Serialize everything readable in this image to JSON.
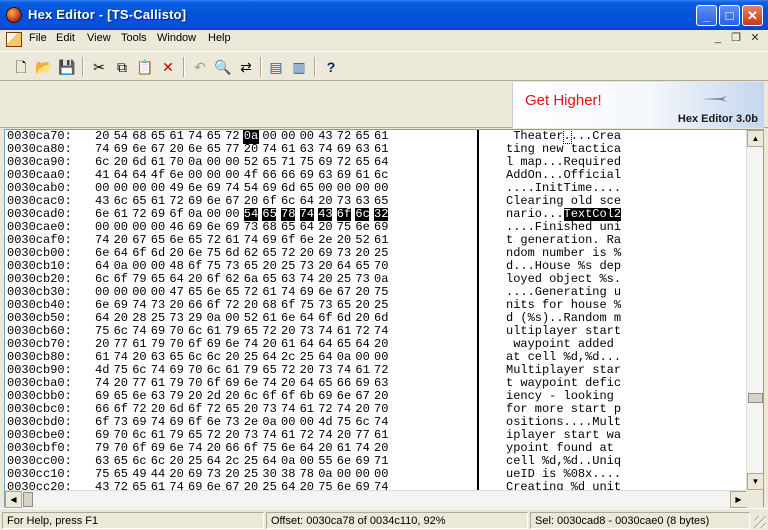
{
  "window": {
    "title": "Hex Editor - [TS-Callisto]"
  },
  "menu": {
    "items": [
      "File",
      "Edit",
      "View",
      "Tools",
      "Window",
      "Help"
    ]
  },
  "toolbar": {
    "buttons": [
      {
        "name": "new-icon",
        "glyph": "🗋"
      },
      {
        "name": "open-icon",
        "glyph": "📂"
      },
      {
        "name": "save-icon",
        "glyph": "💾"
      },
      {
        "name": "cut-icon",
        "glyph": "✂"
      },
      {
        "name": "copy-icon",
        "glyph": "⧉"
      },
      {
        "name": "paste-icon",
        "glyph": "📋"
      },
      {
        "name": "delete-icon",
        "glyph": "✕"
      },
      {
        "name": "undo-icon",
        "glyph": "↶"
      },
      {
        "name": "find-icon",
        "glyph": "🔍"
      },
      {
        "name": "replace-icon",
        "glyph": "⇄"
      },
      {
        "name": "properties-icon",
        "glyph": "▤"
      },
      {
        "name": "export-icon",
        "glyph": "▥"
      },
      {
        "name": "help-icon",
        "glyph": "?"
      }
    ]
  },
  "banner": {
    "headline": "Get Higher!",
    "version": "Hex Editor 3.0b"
  },
  "editor": {
    "rows": [
      {
        "offset": "0030ca70:",
        "hex": "20 54 68 65 61 74 65 72 0a 00 00 00 43 72 65 61",
        "text": " Theater....Crea"
      },
      {
        "offset": "0030ca80:",
        "hex": "74 69 6e 67 20 6e 65 77 20 74 61 63 74 69 63 61",
        "text": "ting new tactica"
      },
      {
        "offset": "0030ca90:",
        "hex": "6c 20 6d 61 70 0a 00 00 52 65 71 75 69 72 65 64",
        "text": "l map...Required"
      },
      {
        "offset": "0030caa0:",
        "hex": "41 64 64 4f 6e 00 00 00 4f 66 66 69 63 69 61 6c",
        "text": "AddOn...Official"
      },
      {
        "offset": "0030cab0:",
        "hex": "00 00 00 00 49 6e 69 74 54 69 6d 65 00 00 00 00",
        "text": "....InitTime...."
      },
      {
        "offset": "0030cac0:",
        "hex": "43 6c 65 61 72 69 6e 67 20 6f 6c 64 20 73 63 65",
        "text": "Clearing old sce"
      },
      {
        "offset": "0030cad0:",
        "hex": "6e 61 72 69 6f 0a 00 00 54 65 78 74 43 6f 6c 32",
        "text": "nario...TextCol2"
      },
      {
        "offset": "0030cae0:",
        "hex": "00 00 00 00 46 69 6e 69 73 68 65 64 20 75 6e 69",
        "text": "....Finished uni"
      },
      {
        "offset": "0030caf0:",
        "hex": "74 20 67 65 6e 65 72 61 74 69 6f 6e 2e 20 52 61",
        "text": "t generation. Ra"
      },
      {
        "offset": "0030cb00:",
        "hex": "6e 64 6f 6d 20 6e 75 6d 62 65 72 20 69 73 20 25",
        "text": "ndom number is %"
      },
      {
        "offset": "0030cb10:",
        "hex": "64 0a 00 00 48 6f 75 73 65 20 25 73 20 64 65 70",
        "text": "d...House %s dep"
      },
      {
        "offset": "0030cb20:",
        "hex": "6c 6f 79 65 64 20 6f 62 6a 65 63 74 20 25 73 0a",
        "text": "loyed object %s."
      },
      {
        "offset": "0030cb30:",
        "hex": "00 00 00 00 47 65 6e 65 72 61 74 69 6e 67 20 75",
        "text": "....Generating u"
      },
      {
        "offset": "0030cb40:",
        "hex": "6e 69 74 73 20 66 6f 72 20 68 6f 75 73 65 20 25",
        "text": "nits for house %"
      },
      {
        "offset": "0030cb50:",
        "hex": "64 20 28 25 73 29 0a 00 52 61 6e 64 6f 6d 20 6d",
        "text": "d (%s)..Random m"
      },
      {
        "offset": "0030cb60:",
        "hex": "75 6c 74 69 70 6c 61 79 65 72 20 73 74 61 72 74",
        "text": "ultiplayer start"
      },
      {
        "offset": "0030cb70:",
        "hex": "20 77 61 79 70 6f 69 6e 74 20 61 64 64 65 64 20",
        "text": " waypoint added "
      },
      {
        "offset": "0030cb80:",
        "hex": "61 74 20 63 65 6c 6c 20 25 64 2c 25 64 0a 00 00",
        "text": "at cell %d,%d..."
      },
      {
        "offset": "0030cb90:",
        "hex": "4d 75 6c 74 69 70 6c 61 79 65 72 20 73 74 61 72",
        "text": "Multiplayer star"
      },
      {
        "offset": "0030cba0:",
        "hex": "74 20 77 61 79 70 6f 69 6e 74 20 64 65 66 69 63",
        "text": "t waypoint defic"
      },
      {
        "offset": "0030cbb0:",
        "hex": "69 65 6e 63 79 20 2d 20 6c 6f 6f 6b 69 6e 67 20",
        "text": "iency - looking "
      },
      {
        "offset": "0030cbc0:",
        "hex": "66 6f 72 20 6d 6f 72 65 20 73 74 61 72 74 20 70",
        "text": "for more start p"
      },
      {
        "offset": "0030cbd0:",
        "hex": "6f 73 69 74 69 6f 6e 73 2e 0a 00 00 4d 75 6c 74",
        "text": "ositions....Mult"
      },
      {
        "offset": "0030cbe0:",
        "hex": "69 70 6c 61 79 65 72 20 73 74 61 72 74 20 77 61",
        "text": "iplayer start wa"
      },
      {
        "offset": "0030cbf0:",
        "hex": "79 70 6f 69 6e 74 20 66 6f 75 6e 64 20 61 74 20",
        "text": "ypoint found at "
      },
      {
        "offset": "0030cc00:",
        "hex": "63 65 6c 6c 20 25 64 2c 25 64 0a 00 55 6e 69 71",
        "text": "cell %d,%d..Uniq"
      },
      {
        "offset": "0030cc10:",
        "hex": "75 65 49 44 20 69 73 20 25 30 38 78 0a 00 00 00",
        "text": "ueID is %08x...."
      },
      {
        "offset": "0030cc20:",
        "hex": "43 72 65 61 74 69 6e 67 20 25 64 20 75 6e 69 74",
        "text": "Creating %d unit"
      }
    ],
    "cursor": {
      "row": 0,
      "col": 8
    },
    "selection": {
      "row": 6,
      "from": 8,
      "to": 15
    }
  },
  "status": {
    "help": "For Help, press F1",
    "offset": "Offset: 0030ca78 of 0034c110, 92%",
    "selection": "Sel: 0030cad8 - 0030cae0 (8 bytes)"
  }
}
